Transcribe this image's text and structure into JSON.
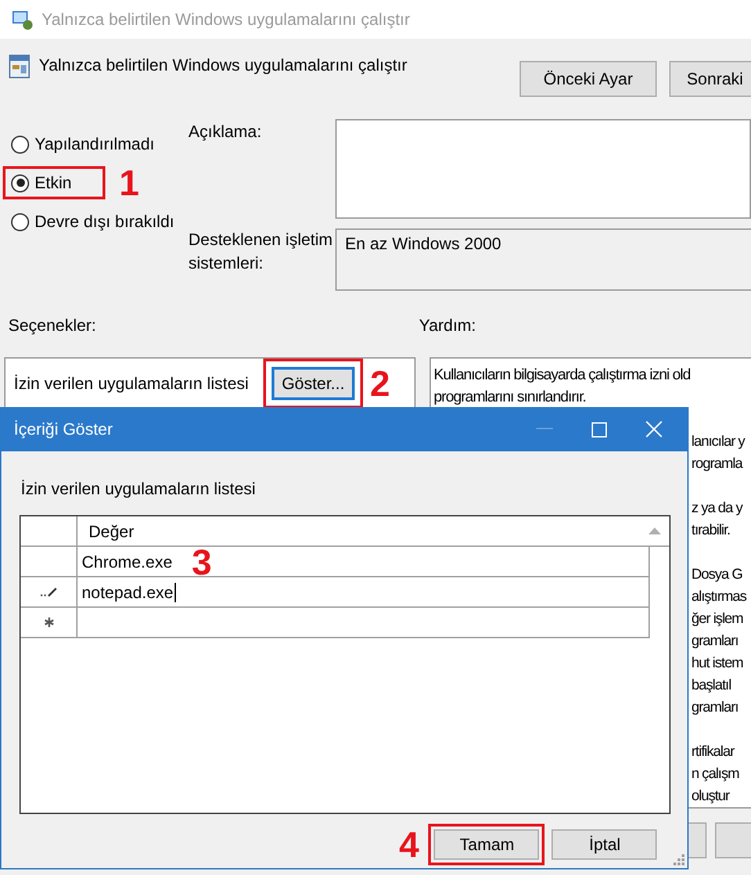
{
  "window": {
    "title": "Yalnızca belirtilen Windows uygulamalarını çalıştır"
  },
  "header": {
    "title": "Yalnızca belirtilen Windows uygulamalarını çalıştır",
    "buttons": [
      "Önceki Ayar",
      "Sonraki"
    ]
  },
  "states": [
    {
      "label": "Yapılandırılmadı",
      "selected": false
    },
    {
      "label": "Etkin",
      "selected": true,
      "annotation": "1"
    },
    {
      "label": "Devre dışı bırakıldı",
      "selected": false
    }
  ],
  "description": {
    "label": "Açıklama:"
  },
  "supported": {
    "label": "Desteklenen işletim sistemleri:",
    "value": "En az Windows 2000"
  },
  "options": {
    "label": "Seçenekler:",
    "item_label": "İzin verilen uygulamaların listesi",
    "button": "Göster...",
    "annotation": "2"
  },
  "help": {
    "label": "Yardım:",
    "lines": [
      "Kullanıcıların bilgisayarda çalıştırma izni old",
      "programlarını sınırlandırır."
    ],
    "partial_groups": [
      [
        "lanıcılar y",
        "rogramla"
      ],
      [
        "z ya da y",
        "tırabilir."
      ],
      [
        "Dosya G",
        "alıştırmas",
        "ğer işlem",
        "gramları",
        "hut istem",
        "başlatıl",
        "gramları"
      ],
      [
        "rtifikalar",
        "n çalışm",
        "oluştur"
      ]
    ]
  },
  "dialog": {
    "title": "İçeriği Göster",
    "list_label": "İzin verilen uygulamaların listesi",
    "column": "Değer",
    "rows": [
      {
        "kind": "row",
        "value": "Chrome.exe"
      },
      {
        "kind": "editing",
        "value": "notepad.exe"
      },
      {
        "kind": "new"
      }
    ],
    "grid_annotation": "3",
    "buttons": [
      {
        "label": "Tamam",
        "highlighted": true,
        "annotation": "4"
      },
      {
        "label": "İptal",
        "highlighted": false
      }
    ]
  }
}
